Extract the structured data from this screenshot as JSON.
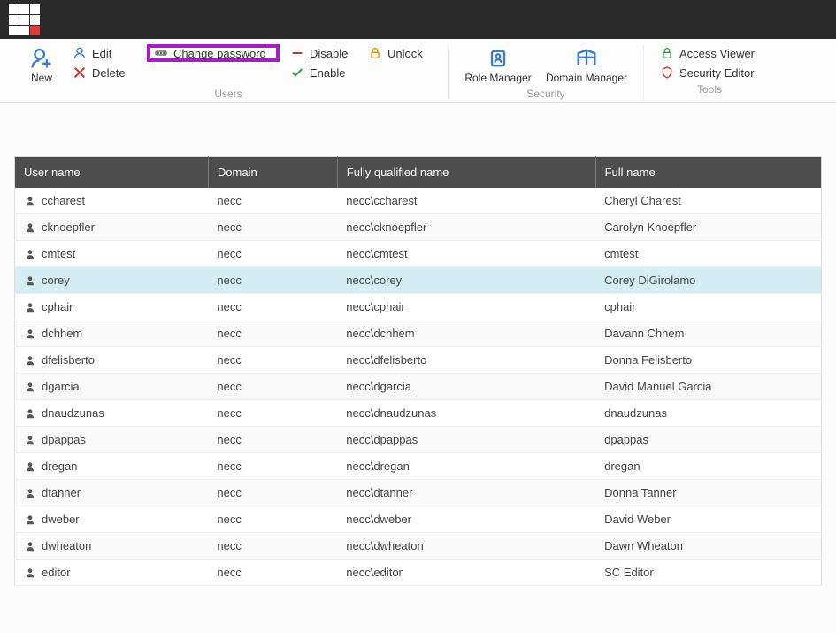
{
  "ribbon": {
    "new": "New",
    "edit": "Edit",
    "delete": "Delete",
    "change_password": "Change password",
    "disable": "Disable",
    "enable": "Enable",
    "unlock": "Unlock",
    "users_group": "Users",
    "role_manager": "Role Manager",
    "domain_manager": "Domain Manager",
    "security_group": "Security",
    "access_viewer": "Access Viewer",
    "security_editor": "Security Editor",
    "tools_group": "Tools"
  },
  "table": {
    "headers": {
      "username": "User name",
      "domain": "Domain",
      "fqn": "Fully qualified name",
      "fullname": "Full name"
    },
    "selected_index": 3,
    "rows": [
      {
        "username": "ccharest",
        "domain": "necc",
        "fqn": "necc\\ccharest",
        "fullname": "Cheryl Charest"
      },
      {
        "username": "cknoepfler",
        "domain": "necc",
        "fqn": "necc\\cknoepfler",
        "fullname": "Carolyn Knoepfler"
      },
      {
        "username": "cmtest",
        "domain": "necc",
        "fqn": "necc\\cmtest",
        "fullname": "cmtest"
      },
      {
        "username": "corey",
        "domain": "necc",
        "fqn": "necc\\corey",
        "fullname": "Corey DiGirolamo"
      },
      {
        "username": "cphair",
        "domain": "necc",
        "fqn": "necc\\cphair",
        "fullname": "cphair"
      },
      {
        "username": "dchhem",
        "domain": "necc",
        "fqn": "necc\\dchhem",
        "fullname": "Davann Chhem"
      },
      {
        "username": "dfelisberto",
        "domain": "necc",
        "fqn": "necc\\dfelisberto",
        "fullname": "Donna Felisberto"
      },
      {
        "username": "dgarcia",
        "domain": "necc",
        "fqn": "necc\\dgarcia",
        "fullname": "David Manuel Garcia"
      },
      {
        "username": "dnaudzunas",
        "domain": "necc",
        "fqn": "necc\\dnaudzunas",
        "fullname": "dnaudzunas"
      },
      {
        "username": "dpappas",
        "domain": "necc",
        "fqn": "necc\\dpappas",
        "fullname": "dpappas"
      },
      {
        "username": "dregan",
        "domain": "necc",
        "fqn": "necc\\dregan",
        "fullname": "dregan"
      },
      {
        "username": "dtanner",
        "domain": "necc",
        "fqn": "necc\\dtanner",
        "fullname": "Donna Tanner"
      },
      {
        "username": "dweber",
        "domain": "necc",
        "fqn": "necc\\dweber",
        "fullname": "David Weber"
      },
      {
        "username": "dwheaton",
        "domain": "necc",
        "fqn": "necc\\dwheaton",
        "fullname": "Dawn Wheaton"
      },
      {
        "username": "editor",
        "domain": "necc",
        "fqn": "necc\\editor",
        "fullname": "SC Editor"
      }
    ]
  }
}
